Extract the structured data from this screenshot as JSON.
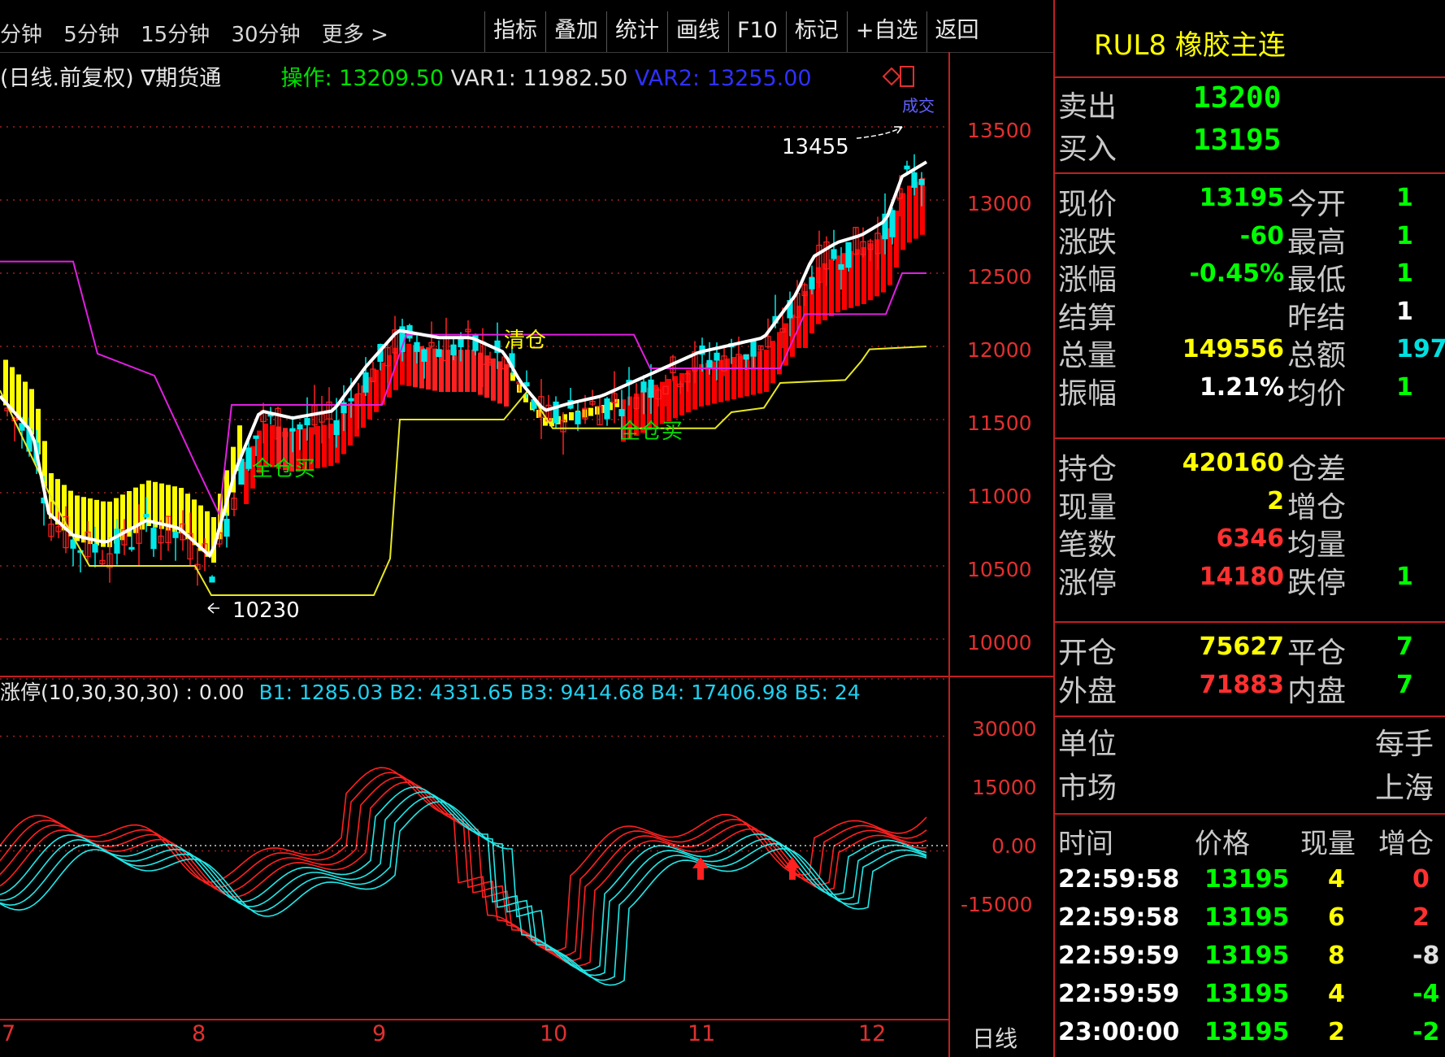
{
  "toolbar": {
    "periods": [
      "分钟",
      "5分钟",
      "15分钟",
      "30分钟",
      "更多 >"
    ],
    "tools": [
      "指标",
      "叠加",
      "统计",
      "画线",
      "F10",
      "标记",
      "+自选",
      "返回"
    ]
  },
  "main_chart": {
    "title": "(日线.前复权) ∇期货通",
    "indicators": [
      {
        "name": "操作",
        "value": "13209.50",
        "color": "#00e000"
      },
      {
        "name": "VAR1",
        "value": "11982.50",
        "color": "#e0e0e0"
      },
      {
        "name": "VAR2",
        "value": "13255.00",
        "color": "#2020ff"
      }
    ],
    "y_ticks": [
      "13500",
      "13000",
      "12500",
      "12000",
      "11500",
      "11000",
      "10500",
      "10000"
    ],
    "annotations": {
      "high": "13455",
      "low": "10230",
      "clear": "清仓",
      "buy1": "全仓买",
      "buy2": "全仓买",
      "corner": "成交"
    },
    "colors": {
      "axis": "#e03030",
      "white_line": "#ffffff",
      "magenta": "#e020e0",
      "yellow_line": "#e8e820",
      "ribbon_yellow": "#ffff00",
      "ribbon_red": "#ff0000",
      "up_candle": "#ff2020",
      "down_candle": "#00e8e8"
    }
  },
  "sub_chart": {
    "title": "涨停(10,30,30,30) : 0.00",
    "params": "B1: 1285.03  B2: 4331.65  B3: 9414.68  B4: 17406.98  B5: 24",
    "y_ticks": [
      "30000",
      "15000",
      "0.00",
      "-15000"
    ],
    "colors": {
      "red": "#ff2020",
      "cyan": "#20e8e8"
    }
  },
  "x_ticks": [
    "7",
    "8",
    "9",
    "10",
    "11",
    "12"
  ],
  "period_label": "日线",
  "quote": {
    "symbol": "RUL8 橡胶主连",
    "ask_label": "卖出",
    "ask": "13200",
    "bid_label": "买入",
    "bid": "13195",
    "rows": [
      {
        "l": "现价",
        "v": "13195",
        "c": "#00ff00",
        "l2": "今开",
        "v2": "1"
      },
      {
        "l": "涨跌",
        "v": "-60",
        "c": "#00ff00",
        "l2": "最高",
        "v2": "1"
      },
      {
        "l": "涨幅",
        "v": "-0.45%",
        "c": "#00ff00",
        "l2": "最低",
        "v2": "1"
      },
      {
        "l": "结算",
        "v": "",
        "c": "#ffffff",
        "l2": "昨结",
        "v2": "1"
      },
      {
        "l": "总量",
        "v": "149556",
        "c": "#ffff00",
        "l2": "总额",
        "v2": "197"
      },
      {
        "l": "振幅",
        "v": "1.21%",
        "c": "#ffffff",
        "l2": "均价",
        "v2": "1"
      }
    ],
    "rows2": [
      {
        "l": "持仓",
        "v": "420160",
        "c": "#ffff00",
        "l2": "仓差",
        "v2": ""
      },
      {
        "l": "现量",
        "v": "2",
        "c": "#ffff00",
        "l2": "增仓",
        "v2": ""
      },
      {
        "l": "笔数",
        "v": "6346",
        "c": "#ff3030",
        "l2": "均量",
        "v2": ""
      },
      {
        "l": "涨停",
        "v": "14180",
        "c": "#ff3030",
        "l2": "跌停",
        "v2": "1"
      }
    ],
    "rows3": [
      {
        "l": "开仓",
        "v": "75627",
        "c": "#ffff00",
        "l2": "平仓",
        "v2": "7"
      },
      {
        "l": "外盘",
        "v": "71883",
        "c": "#ff3030",
        "l2": "内盘",
        "v2": "7"
      }
    ],
    "unit_label": "单位",
    "unit_value": "每手",
    "market_label": "市场",
    "market_value": "上海",
    "ticks_header": [
      "时间",
      "价格",
      "现量",
      "增仓"
    ],
    "ticks": [
      {
        "t": "22:59:58",
        "p": "13195",
        "q": "4",
        "d": "0",
        "dc": "#ff3030"
      },
      {
        "t": "22:59:58",
        "p": "13195",
        "q": "6",
        "d": "2",
        "dc": "#ff3030"
      },
      {
        "t": "22:59:59",
        "p": "13195",
        "q": "8",
        "d": "-8",
        "dc": "#e0e0e0"
      },
      {
        "t": "22:59:59",
        "p": "13195",
        "q": "4",
        "d": "-4",
        "dc": "#00ff00"
      },
      {
        "t": "23:00:00",
        "p": "13195",
        "q": "2",
        "d": "-2",
        "dc": "#00ff00"
      }
    ]
  }
}
